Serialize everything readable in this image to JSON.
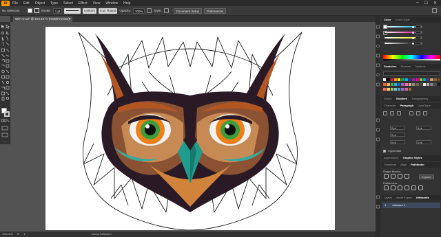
{
  "app": {
    "logo": "Ai"
  },
  "menu": [
    "File",
    "Edit",
    "Object",
    "Type",
    "Select",
    "Effect",
    "View",
    "Window",
    "Help"
  ],
  "window_controls": [
    "–",
    "☐",
    "✕"
  ],
  "control_bar": {
    "selection_label": "No Selection",
    "stroke_label": "Stroke:",
    "stroke_weight": "1 pt",
    "profile_label": "Uniform",
    "brush_label": "5 pt. Round",
    "opacity_label": "Opacity:",
    "opacity_value": "100%",
    "style_label": "Style:",
    "document_setup": "Document Setup",
    "preferences": "Preferences"
  },
  "document_tab": {
    "title": "WIT Art.ai* @ 104.16 % (RGB/Preview)",
    "close": "✕"
  },
  "status_bar": {
    "zoom": "104.16%",
    "angle": "0°",
    "artboard": "1",
    "tool": "Group Selection"
  },
  "right_panel": {
    "color_tabs": [
      "Color",
      "Color Guide"
    ],
    "color_values": [
      "0",
      "0",
      "0",
      "0"
    ],
    "swatches_tabs": [
      "Swatches",
      "Brushes",
      "Symbols"
    ],
    "stroke_tabs": [
      "Stroke",
      "Gradient",
      "Transparency"
    ],
    "char_tabs": [
      "Character",
      "Paragraph",
      "OpenType"
    ],
    "para_values": [
      "0 pt",
      "0 pt",
      "0 pt",
      "0 pt",
      "0 pt"
    ],
    "hyphenate": "Hyphenate",
    "appearance_tabs": [
      "Appearance",
      "Graphic Styles"
    ],
    "transform_tabs": [
      "Transform",
      "Align",
      "Pathfinder"
    ],
    "shape_modes": "Shape Modes:",
    "expand": "Expand",
    "pathfinders": "Pathfinders:",
    "layers_tabs": [
      "Layers",
      "Asset Export",
      "Artboards"
    ],
    "artboard_item": {
      "index": "1",
      "name": "Artboard 1"
    }
  },
  "colors": {
    "owl_eye_orange": "#f07f1a",
    "owl_iris_green": "#3f9c3a",
    "owl_beak_teal": "#1f9c8c",
    "owl_dark": "#2a1a26",
    "owl_brown": "#8a5233",
    "owl_rust": "#b25624"
  }
}
